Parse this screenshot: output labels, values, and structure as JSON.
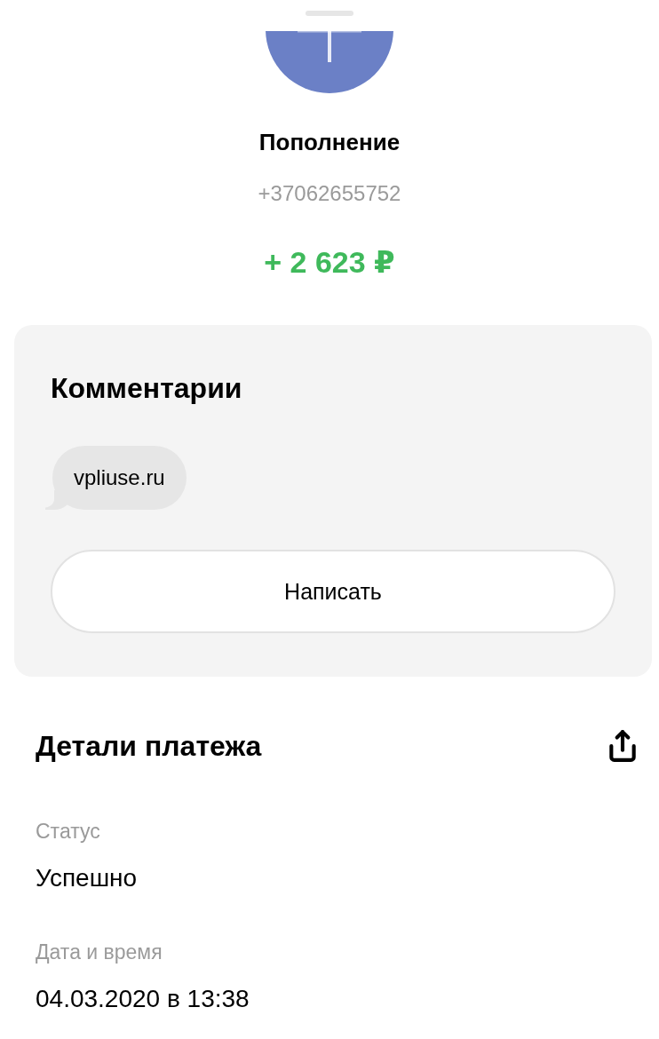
{
  "transaction": {
    "title": "Пополнение",
    "phone": "+37062655752",
    "amount": "+ 2 623 ₽"
  },
  "comments": {
    "title": "Комментарии",
    "messages": [
      {
        "text": "vpliuse.ru"
      }
    ],
    "write_button": "Написать"
  },
  "details": {
    "title": "Детали платежа",
    "fields": [
      {
        "label": "Статус",
        "value": "Успешно"
      },
      {
        "label": "Дата и время",
        "value": "04.03.2020 в 13:38"
      }
    ]
  }
}
